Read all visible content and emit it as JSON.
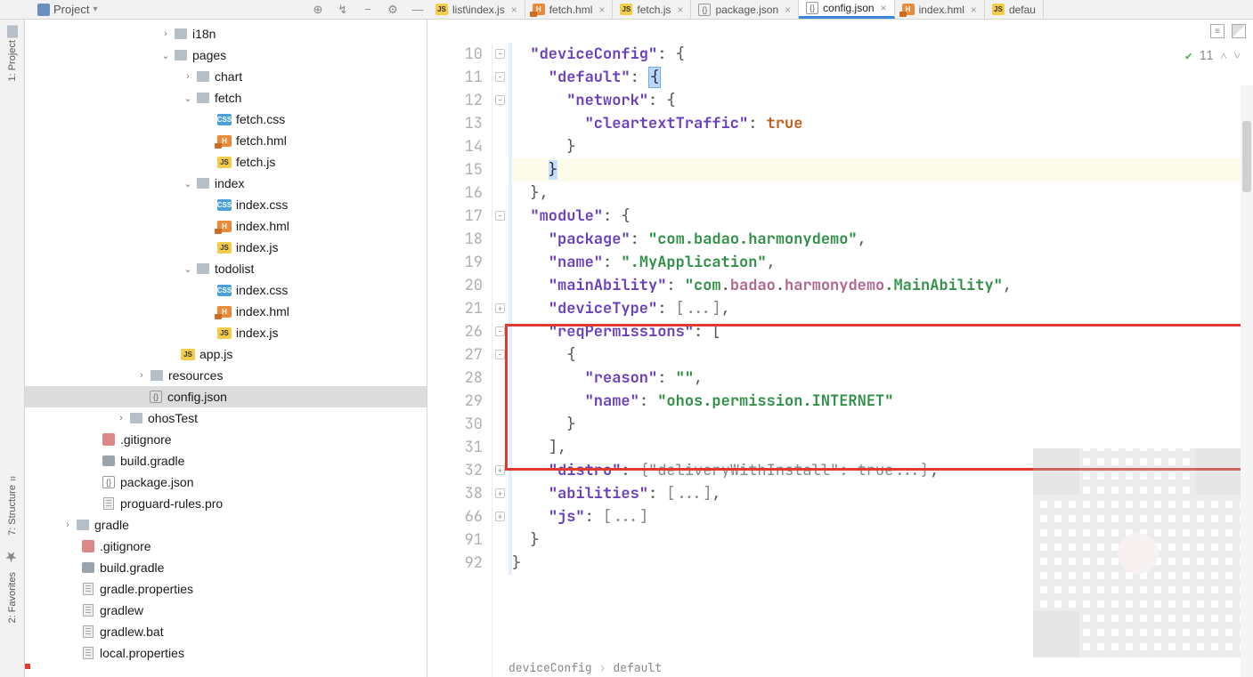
{
  "topbar": {
    "project_label": "Project"
  },
  "left_tabs": {
    "project": "1: Project",
    "structure": "7: Structure",
    "favorites": "2: Favorites"
  },
  "tree": {
    "i18n": "i18n",
    "pages": "pages",
    "chart": "chart",
    "fetch": "fetch",
    "fetch_css": "fetch.css",
    "fetch_hml": "fetch.hml",
    "fetch_js": "fetch.js",
    "index": "index",
    "index_css": "index.css",
    "index_hml": "index.hml",
    "index_js": "index.js",
    "todolist": "todolist",
    "todolist_css": "index.css",
    "todolist_hml": "index.hml",
    "todolist_js": "index.js",
    "app_js": "app.js",
    "resources": "resources",
    "config_json": "config.json",
    "ohosTest": "ohosTest",
    "gitignore": ".gitignore",
    "build_gradle": "build.gradle",
    "package_json": "package.json",
    "proguard": "proguard-rules.pro",
    "gradle": "gradle",
    "root_gitignore": ".gitignore",
    "root_build_gradle": "build.gradle",
    "gradle_properties": "gradle.properties",
    "gradlew": "gradlew",
    "gradlew_bat": "gradlew.bat",
    "local_properties": "local.properties"
  },
  "tabs": {
    "t0": "list\\index.js",
    "t1": "fetch.hml",
    "t2": "fetch.js",
    "t3": "package.json",
    "t4": "config.json",
    "t5": "index.hml",
    "t6": "defau"
  },
  "status": {
    "count": "11"
  },
  "gutter": [
    "10",
    "11",
    "12",
    "13",
    "14",
    "15",
    "16",
    "17",
    "18",
    "19",
    "20",
    "21",
    "26",
    "27",
    "28",
    "29",
    "30",
    "31",
    "32",
    "38",
    "66",
    "91",
    "92"
  ],
  "code": {
    "l10_key": "\"deviceConfig\"",
    "l11_key": "\"default\"",
    "l12_key": "\"network\"",
    "l13_key": "\"cleartextTraffic\"",
    "l13_val": "true",
    "l17_key": "\"module\"",
    "l18_key": "\"package\"",
    "l18_val": "\"com.badao.harmonydemo\"",
    "l19_key": "\"name\"",
    "l19_val": "\".MyApplication\"",
    "l20_key": "\"mainAbility\"",
    "l20_a": "\"com",
    "l20_b": "badao",
    "l20_c": "harmonydemo",
    "l20_d": ".MainAbility\"",
    "l21_key": "\"deviceType\"",
    "l21_fold": "[...]",
    "l26_key": "\"reqPermissions\"",
    "l28_key": "\"reason\"",
    "l28_val": "\"\"",
    "l29_key": "\"name\"",
    "l29_val": "\"ohos.permission.INTERNET\"",
    "l32_key": "\"distro\"",
    "l32_inner_key": "\"deliveryWithInstall\"",
    "l32_inner_val": "true...",
    "l38_key": "\"abilities\"",
    "l38_fold": "[...]",
    "l66_key": "\"js\"",
    "l66_fold": "[...]"
  },
  "breadcrumb": {
    "a": "deviceConfig",
    "b": "default"
  }
}
